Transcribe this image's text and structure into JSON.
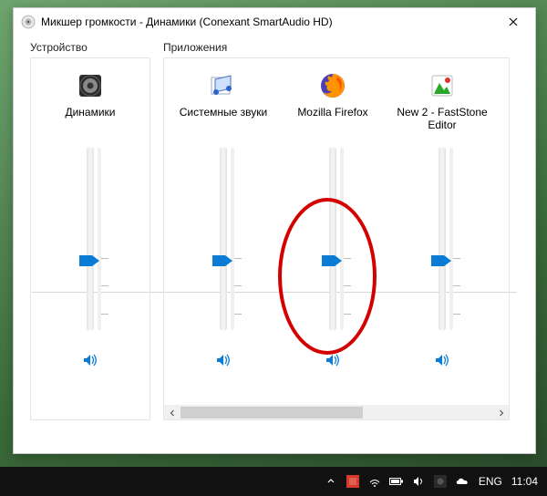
{
  "window": {
    "title": "Микшер громкости - Динамики (Conexant SmartAudio HD)"
  },
  "groups": {
    "device_label": "Устройство",
    "apps_label": "Приложения"
  },
  "device": {
    "label": "Динамики",
    "volume_percent": 38,
    "muted": false
  },
  "apps": [
    {
      "label": "Системные звуки",
      "volume_percent": 38,
      "muted": false
    },
    {
      "label": "Mozilla Firefox",
      "volume_percent": 38,
      "muted": false
    },
    {
      "label": "New 2 - FastStone Editor",
      "volume_percent": 38,
      "muted": false
    }
  ],
  "taskbar": {
    "lang": "ENG",
    "time": "11:04"
  },
  "annotation": {
    "highlight_target": "Mozilla Firefox"
  }
}
